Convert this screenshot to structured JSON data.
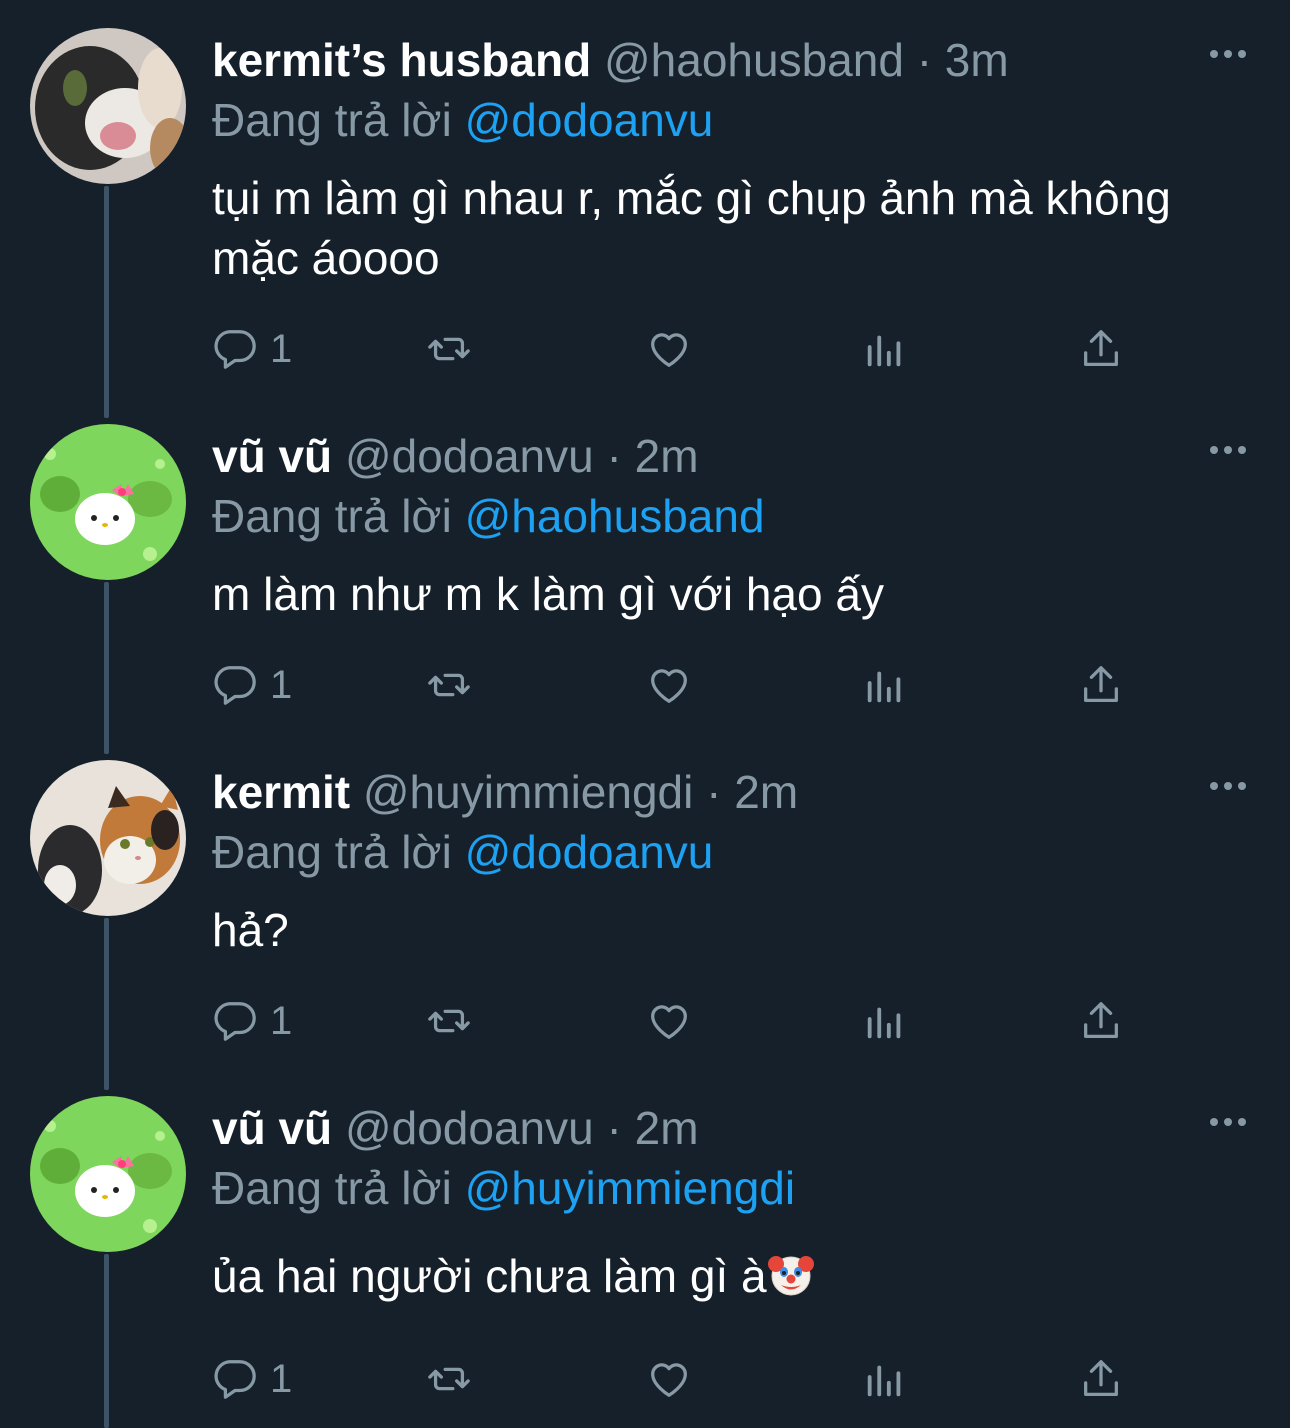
{
  "tweets": [
    {
      "name": "kermit’s husband",
      "handle": "@haohusband",
      "dot": "·",
      "time": "3m",
      "reply_prefix": "Đang trả lời",
      "reply_to": "@dodoanvu",
      "text": "tụi m làm gì nhau r, mắc gì chụp ảnh mà không mặc áoooo",
      "reply_count": "1",
      "avatar": "cat-black-white-avatar"
    },
    {
      "name": "vũ vũ",
      "handle": "@dodoanvu",
      "dot": "·",
      "time": "2m",
      "reply_prefix": "Đang trả lời",
      "reply_to": "@haohusband",
      "text": "m làm như m k làm gì với hạo ấy",
      "reply_count": "1",
      "avatar": "green-kitty-avatar"
    },
    {
      "name": "kermit",
      "handle": "@huyimmiengdi",
      "dot": "·",
      "time": "2m",
      "reply_prefix": "Đang trả lời",
      "reply_to": "@dodoanvu",
      "text": "hả?",
      "reply_count": "1",
      "avatar": "calico-cat-avatar"
    },
    {
      "name": "vũ vũ",
      "handle": "@dodoanvu",
      "dot": "·",
      "time": "2m",
      "reply_prefix": "Đang trả lời",
      "reply_to": "@huyimmiengdi",
      "text": "ủa hai người chưa làm gì à",
      "text_emoji": "clown-face-emoji",
      "reply_count": "1",
      "avatar": "green-kitty-avatar"
    }
  ],
  "colors": {
    "background": "#15202b",
    "secondary_text": "#8899a6",
    "mention": "#1da1f2",
    "thread_line": "#3d5466"
  },
  "icons": [
    "reply-icon",
    "retweet-icon",
    "like-icon",
    "analytics-icon",
    "share-icon",
    "more-icon"
  ]
}
